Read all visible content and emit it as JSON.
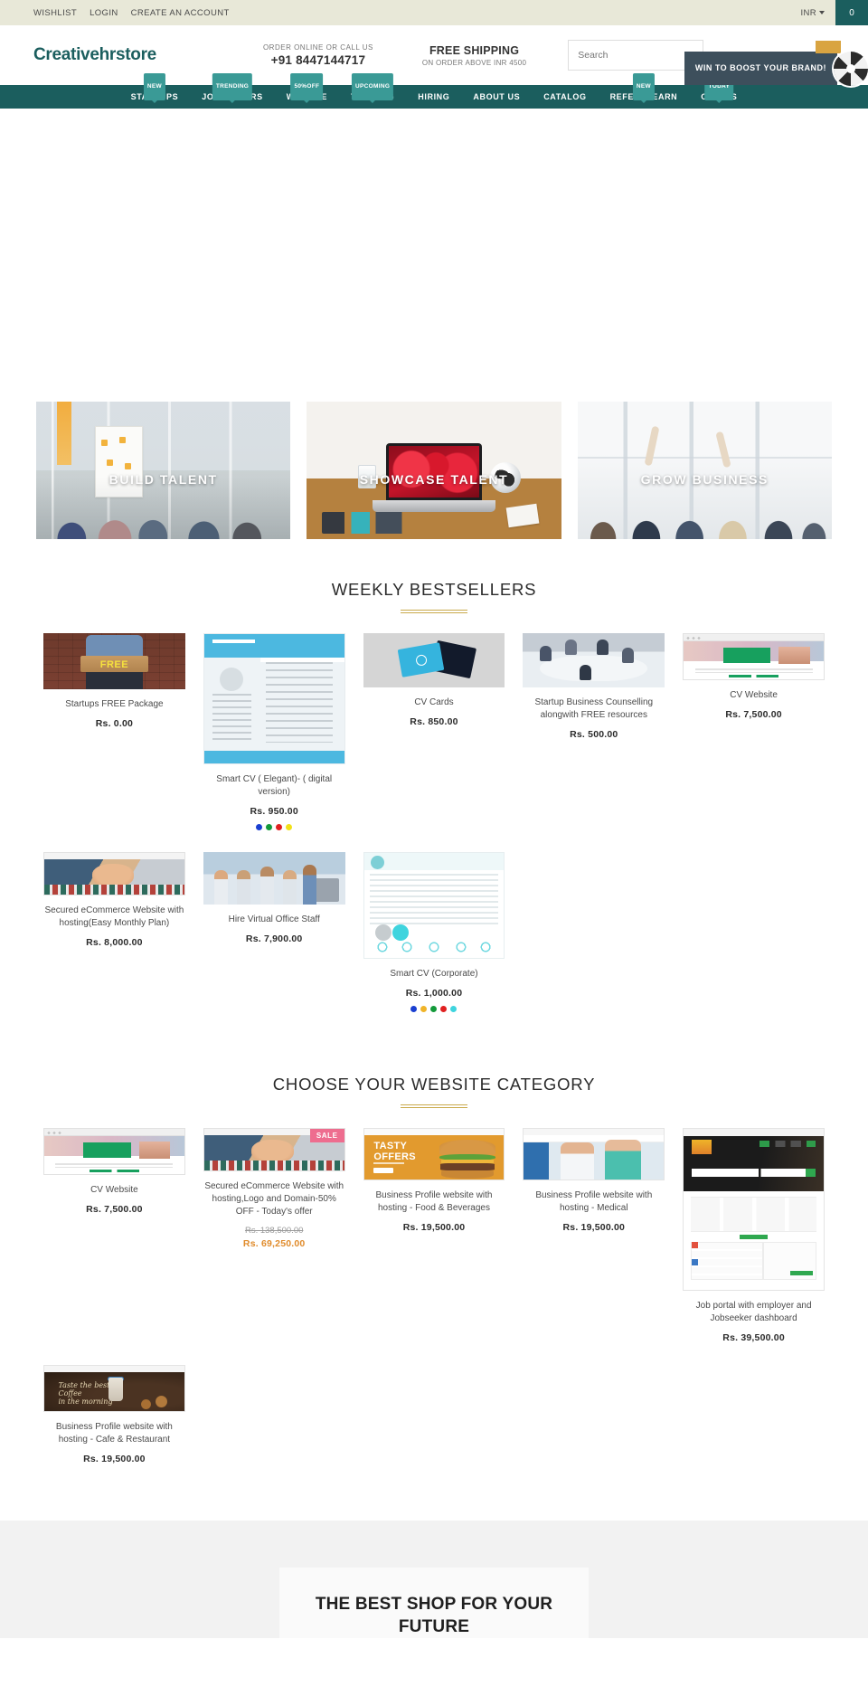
{
  "topbar": {
    "links": [
      {
        "label": "WISHLIST",
        "name": "wishlist-link"
      },
      {
        "label": "LOGIN",
        "name": "login-link"
      },
      {
        "label": "CREATE AN ACCOUNT",
        "name": "create-account-link"
      }
    ],
    "currency": "INR",
    "cart_count": "0"
  },
  "header": {
    "logo": "Creativehrstore",
    "order_label": "ORDER ONLINE OR CALL US",
    "phone": "+91 8447144717",
    "shipping_title": "FREE SHIPPING",
    "shipping_sub": "ON ORDER ABOVE INR 4500",
    "search_placeholder": "Search",
    "promo_label": "WIN TO BOOST YOUR BRAND!"
  },
  "nav": {
    "items": [
      {
        "label": "STARTUPS",
        "badge": "NEW",
        "name": "nav-startups"
      },
      {
        "label": "JOBSEEKERS",
        "badge": "TRENDING",
        "name": "nav-jobseekers"
      },
      {
        "label": "WEBSITE",
        "badge": "50%OFF",
        "name": "nav-website"
      },
      {
        "label": "TRAINING",
        "badge": "UPCOMING",
        "name": "nav-training"
      },
      {
        "label": "HIRING",
        "badge": "",
        "name": "nav-hiring"
      },
      {
        "label": "ABOUT US",
        "badge": "",
        "name": "nav-about-us"
      },
      {
        "label": "CATALOG",
        "badge": "",
        "name": "nav-catalog"
      },
      {
        "label": "REFER & EARN",
        "badge": "NEW",
        "name": "nav-refer-earn"
      },
      {
        "label": "OFFERS",
        "badge": "TODAY",
        "name": "nav-offers"
      }
    ]
  },
  "banners": [
    {
      "label": "BUILD TALENT",
      "name": "banner-build-talent"
    },
    {
      "label": "SHOWCASE TALENT",
      "name": "banner-showcase-talent"
    },
    {
      "label": "GROW BUSINESS",
      "name": "banner-grow-business"
    }
  ],
  "bestsellers": {
    "title": "WEEKLY BESTSELLERS",
    "products": [
      {
        "name": "Startups FREE Package",
        "price": "Rs. 0.00",
        "art": "t-free"
      },
      {
        "name": "Smart CV ( Elegant)- ( digital version)",
        "price": "Rs. 950.00",
        "art": "t-cv",
        "swatches": [
          "#1a3fd1",
          "#139a3a",
          "#e02020",
          "#f2e118"
        ]
      },
      {
        "name": "CV Cards",
        "price": "Rs. 850.00",
        "art": "t-cards"
      },
      {
        "name": "Startup Business Counselling alongwith FREE resources",
        "price": "Rs. 500.00",
        "art": "t-meet"
      },
      {
        "name": "CV Website",
        "price": "Rs. 7,500.00",
        "art": "t-web"
      },
      {
        "name": "Secured eCommerce Website with hosting(Easy Monthly Plan)",
        "price": "Rs. 8,000.00",
        "art": "t-ecom"
      },
      {
        "name": "Hire Virtual Office Staff",
        "price": "Rs. 7,900.00",
        "art": "t-staff"
      },
      {
        "name": "Smart CV (Corporate)",
        "price": "Rs. 1,000.00",
        "art": "t-cvc",
        "swatches": [
          "#1a3fd1",
          "#f0b429",
          "#139a3a",
          "#e02020",
          "#3fd4de"
        ]
      }
    ]
  },
  "categories": {
    "title": "CHOOSE YOUR WEBSITE CATEGORY",
    "products": [
      {
        "name": "CV Website",
        "price": "Rs. 7,500.00",
        "art": "t-web"
      },
      {
        "name": "Secured eCommerce Website with hosting,Logo and Domain-50% OFF - Today's offer",
        "old_price": "Rs. 138,500.00",
        "sale_price": "Rs. 69,250.00",
        "badge": "SALE",
        "art": "t-ecom"
      },
      {
        "name": "Business Profile website with hosting - Food & Beverages",
        "price": "Rs. 19,500.00",
        "art": "t-food"
      },
      {
        "name": "Business Profile website with hosting - Medical",
        "price": "Rs. 19,500.00",
        "art": "t-med"
      },
      {
        "name": "Job portal with employer and Jobseeker dashboard",
        "price": "Rs. 39,500.00",
        "art": "t-job"
      },
      {
        "name": "Business Profile website with hosting - Cafe & Restaurant",
        "price": "Rs. 19,500.00",
        "art": "t-cafe"
      }
    ]
  },
  "footer_teaser": {
    "heading": "THE BEST SHOP FOR YOUR FUTURE"
  },
  "colors": {
    "brand_teal": "#1b5e5e",
    "badge_teal": "#3a9a96",
    "topbar_bg": "#e8e8d8",
    "gold_rule": "#c9a94b",
    "sale_pink": "#ee6d8f",
    "sale_orange": "#e08b2b",
    "promo_slate": "#3d4f5c"
  }
}
